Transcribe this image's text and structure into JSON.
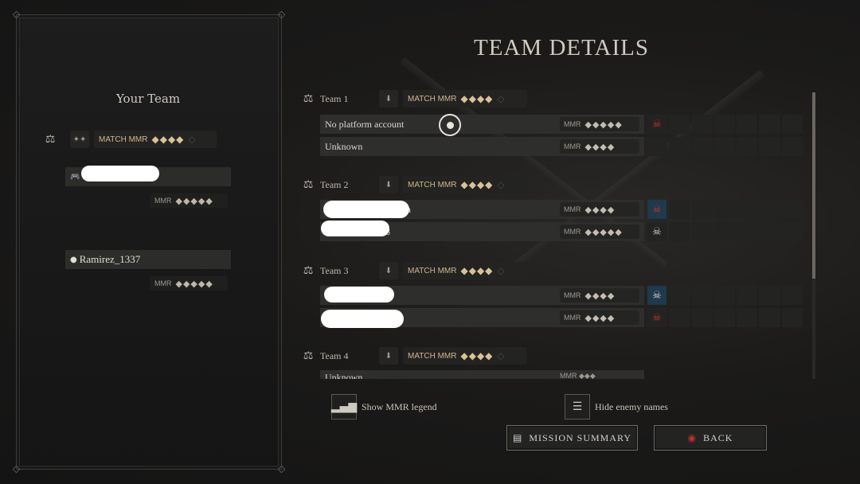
{
  "title": "TEAM DETAILS",
  "your_team": {
    "heading": "Your Team",
    "match_label": "MATCH MMR",
    "match_stars": "◆◆◆◆",
    "players": [
      {
        "name": "",
        "mmr_label": "MMR",
        "mmr_stars": "◆◆◆◆◆",
        "platform_icon": "gamepad-icon"
      },
      {
        "name": "Ramirez_1337",
        "mmr_label": "MMR",
        "mmr_stars": "◆◆◆◆◆",
        "platform_icon": "steam-icon"
      }
    ]
  },
  "teams": [
    {
      "name": "Team 1",
      "match_label": "MATCH MMR",
      "match_stars": "◆◆◆◆",
      "players": [
        {
          "name": "No platform account",
          "mmr_label": "MMR",
          "mmr_stars": "◆◆◆◆◆",
          "badge": "skull-red"
        },
        {
          "name": "Unknown",
          "mmr_label": "MMR",
          "mmr_stars": "◆◆◆◆",
          "badge": ""
        }
      ]
    },
    {
      "name": "Team 2",
      "match_label": "MATCH MMR",
      "match_stars": "◆◆◆◆",
      "players": [
        {
          "name": "n",
          "mmr_label": "MMR",
          "mmr_stars": "◆◆◆◆",
          "badge": "skull-red"
        },
        {
          "name": "88",
          "mmr_label": "MMR",
          "mmr_stars": "◆◆◆◆◆",
          "badge": "skull-grey"
        }
      ]
    },
    {
      "name": "Team 3",
      "match_label": "MATCH MMR",
      "match_stars": "◆◆◆◆",
      "players": [
        {
          "name": "",
          "mmr_label": "MMR",
          "mmr_stars": "◆◆◆◆",
          "badge": "skull-grey"
        },
        {
          "name": "",
          "mmr_label": "MMR",
          "mmr_stars": "◆◆◆◆",
          "badge": "skull-red"
        }
      ]
    },
    {
      "name": "Team 4",
      "match_label": "MATCH MMR",
      "match_stars": "◆◆◆◆",
      "players": [
        {
          "name": "Unknown",
          "mmr_label": "MMR",
          "mmr_stars": "◆◆◆"
        }
      ]
    }
  ],
  "options": {
    "show_mmr_legend": "Show MMR legend",
    "hide_enemy_names": "Hide enemy names"
  },
  "buttons": {
    "mission_summary": "MISSION SUMMARY",
    "back": "BACK"
  },
  "colors": {
    "accent_gold": "#d9c296",
    "badge_blue": "#1e3a4c",
    "skull_red": "#c0302a"
  }
}
